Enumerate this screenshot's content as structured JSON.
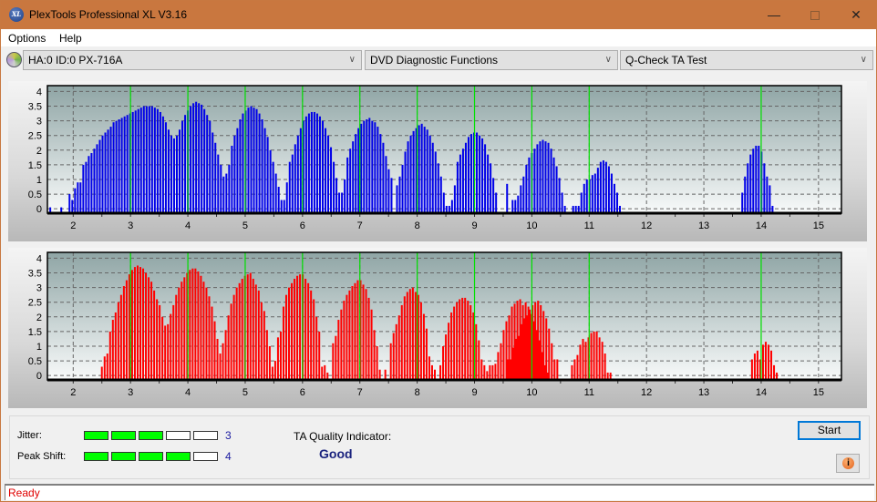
{
  "window": {
    "title": "PlexTools Professional XL V3.16",
    "app_icon_text": "XL",
    "minimize": "—",
    "close": "✕"
  },
  "menu": {
    "items": [
      "Options",
      "Help"
    ]
  },
  "toolbar": {
    "drive": "HA:0 ID:0  PX-716A",
    "function": "DVD Diagnostic Functions",
    "test": "Q-Check TA Test",
    "chevron": "∨"
  },
  "metrics": {
    "jitter_label": "Jitter:",
    "jitter_value": "3",
    "jitter_level": 3,
    "peak_shift_label": "Peak Shift:",
    "peak_shift_value": "4",
    "peak_shift_level": 4,
    "max_level": 5,
    "ta_quality_label": "TA Quality Indicator:",
    "ta_quality_value": "Good"
  },
  "buttons": {
    "start": "Start",
    "info": "i"
  },
  "status": {
    "text": "Ready"
  },
  "colors": {
    "blue_bars": "#0000e8",
    "red_bars": "#ff0000",
    "marker_lines": "#00e000",
    "meter_on": "#00ff00",
    "status_text": "#e00000",
    "quality_text": "#1a237e"
  },
  "chart_data": [
    {
      "type": "bar",
      "name": "top-chart",
      "title": "",
      "xlabel": "",
      "ylabel": "",
      "xlim": [
        1.55,
        15.4
      ],
      "ylim": [
        -0.15,
        4.2
      ],
      "x_ticks": [
        2,
        3,
        4,
        5,
        6,
        7,
        8,
        9,
        10,
        11,
        12,
        13,
        14,
        15
      ],
      "y_ticks": [
        0,
        0.5,
        1,
        1.5,
        2,
        2.5,
        3,
        3.5,
        4
      ],
      "y_tick_labels": [
        "0",
        "0.5",
        "1",
        "1.5",
        "2",
        "2.5",
        "3",
        "3.5",
        "4"
      ],
      "marker_lines": [
        3,
        4,
        5,
        6,
        7,
        8,
        9,
        10,
        11,
        14
      ],
      "grid": true,
      "x_start": 1.6,
      "x_step": 0.048,
      "values": [
        0.05,
        0,
        0,
        0,
        0.05,
        0,
        0,
        0.5,
        0.3,
        0.7,
        0.9,
        0.9,
        1.5,
        1.6,
        1.8,
        1.9,
        2.05,
        2.2,
        2.35,
        2.5,
        2.6,
        2.7,
        2.8,
        2.95,
        3.0,
        3.05,
        3.1,
        3.15,
        3.2,
        3.25,
        3.3,
        3.35,
        3.4,
        3.45,
        3.5,
        3.5,
        3.5,
        3.5,
        3.45,
        3.4,
        3.3,
        3.15,
        2.95,
        2.7,
        2.5,
        2.4,
        2.5,
        2.7,
        3.0,
        3.2,
        3.35,
        3.5,
        3.6,
        3.65,
        3.6,
        3.55,
        3.4,
        3.2,
        3.0,
        2.6,
        2.25,
        1.85,
        1.5,
        1.1,
        1.2,
        1.5,
        2.15,
        2.5,
        2.75,
        3.05,
        3.25,
        3.35,
        3.45,
        3.5,
        3.45,
        3.4,
        3.25,
        3.05,
        2.75,
        2.45,
        2.0,
        1.6,
        1.2,
        0.75,
        0.3,
        0.3,
        0.9,
        1.6,
        1.85,
        2.2,
        2.5,
        2.75,
        3.0,
        3.15,
        3.25,
        3.3,
        3.3,
        3.25,
        3.15,
        3.0,
        2.75,
        2.5,
        2.1,
        1.6,
        1.05,
        0.55,
        0.55,
        1.0,
        1.75,
        2.05,
        2.3,
        2.55,
        2.75,
        2.9,
        3.0,
        3.05,
        3.1,
        3.0,
        2.95,
        2.8,
        2.55,
        2.25,
        1.8,
        1.35,
        1.05,
        0.0,
        0.8,
        1.1,
        1.5,
        1.95,
        2.3,
        2.5,
        2.65,
        2.75,
        2.85,
        2.9,
        2.8,
        2.7,
        2.5,
        2.25,
        1.95,
        1.55,
        1.1,
        0.55,
        0.1,
        0.1,
        0.3,
        0.8,
        1.6,
        1.85,
        2.05,
        2.25,
        2.45,
        2.55,
        2.6,
        2.6,
        2.5,
        2.4,
        2.2,
        1.85,
        1.55,
        1.05,
        0.55,
        0.0,
        0.0,
        0.0,
        0.85,
        0.0,
        0.3,
        0.3,
        0.45,
        0.8,
        1.1,
        1.5,
        1.75,
        1.9,
        2.05,
        2.2,
        2.3,
        2.35,
        2.3,
        2.25,
        2.05,
        1.75,
        1.45,
        1.05,
        0.55,
        0.1,
        0,
        0,
        0.1,
        0.1,
        0.1,
        0.55,
        0.85,
        1.0,
        1.0,
        1.15,
        1.2,
        1.4,
        1.6,
        1.65,
        1.6,
        1.45,
        1.2,
        0.85,
        0.55,
        0.1
      ],
      "cluster_14": {
        "x_start": 13.67,
        "x_step": 0.048,
        "values": [
          0.55,
          1.1,
          1.55,
          1.85,
          2.05,
          2.15,
          2.15,
          1.95,
          1.55,
          1.1,
          0.8,
          0.1
        ]
      }
    },
    {
      "type": "bar",
      "name": "bottom-chart",
      "title": "",
      "xlabel": "",
      "ylabel": "",
      "xlim": [
        1.55,
        15.4
      ],
      "ylim": [
        -0.15,
        4.2
      ],
      "x_ticks": [
        2,
        3,
        4,
        5,
        6,
        7,
        8,
        9,
        10,
        11,
        12,
        13,
        14,
        15
      ],
      "y_ticks": [
        0,
        0.5,
        1,
        1.5,
        2,
        2.5,
        3,
        3.5,
        4
      ],
      "y_tick_labels": [
        "0",
        "0.5",
        "1",
        "1.5",
        "2",
        "2.5",
        "3",
        "3.5",
        "4"
      ],
      "marker_lines": [
        3,
        4,
        5,
        6,
        7,
        8,
        9,
        10,
        11,
        14
      ],
      "grid": true,
      "x_start": 2.5,
      "x_step": 0.048,
      "values": [
        0.3,
        0.65,
        0.75,
        1.5,
        1.9,
        2.15,
        2.5,
        2.75,
        3.05,
        3.25,
        3.45,
        3.6,
        3.7,
        3.75,
        3.7,
        3.65,
        3.5,
        3.35,
        3.2,
        2.9,
        2.6,
        2.4,
        2.0,
        1.7,
        1.75,
        2.1,
        2.4,
        2.75,
        3.0,
        3.2,
        3.35,
        3.5,
        3.6,
        3.65,
        3.65,
        3.55,
        3.4,
        3.2,
        3.0,
        2.7,
        2.35,
        1.85,
        1.25,
        0.75,
        1.1,
        1.55,
        2.05,
        2.45,
        2.75,
        3.0,
        3.15,
        3.3,
        3.4,
        3.45,
        3.5,
        3.3,
        3.1,
        2.9,
        2.5,
        2.2,
        1.55,
        1.0,
        0.3,
        0.5,
        1.3,
        1.5,
        2.35,
        2.75,
        3.0,
        3.15,
        3.3,
        3.4,
        3.45,
        3.45,
        3.3,
        3.15,
        2.9,
        2.6,
        2.0,
        1.5,
        0.3,
        0.35,
        0.1,
        0,
        1.1,
        1.35,
        1.9,
        2.25,
        2.55,
        2.75,
        2.9,
        3.05,
        3.15,
        3.25,
        3.25,
        3.1,
        2.95,
        2.65,
        2.25,
        1.55,
        1.0,
        0.2,
        0.0,
        0.2,
        0.0,
        1.1,
        1.45,
        1.75,
        2.05,
        2.4,
        2.7,
        2.85,
        2.95,
        3.0,
        2.85,
        2.75,
        2.5,
        2.1,
        1.6,
        0.65,
        0.35,
        0.2,
        0.0,
        0.35,
        1.0,
        1.4,
        1.8,
        2.15,
        2.35,
        2.5,
        2.6,
        2.65,
        2.65,
        2.55,
        2.4,
        2.15,
        1.75,
        1.2,
        0.55,
        0.35,
        0.15,
        0.35,
        0.35,
        0.4,
        0.8,
        1.1,
        1.55,
        1.85,
        2.05,
        2.35,
        2.45,
        2.55,
        2.6,
        2.4,
        2.5,
        2.35,
        2.1,
        1.85,
        1.55,
        1.2,
        0.8,
        0.35,
        0.1
      ],
      "cluster_10": {
        "x_start": 9.58,
        "x_step": 0.048,
        "values": [
          0.55,
          0.55,
          0.95,
          1.25,
          1.35,
          1.75,
          1.95,
          2.05,
          2.25,
          2.4,
          2.5,
          2.55,
          2.4,
          2.2,
          1.95,
          1.6,
          1.1,
          0.55,
          0.55
        ]
      },
      "cluster_11": {
        "x_start": 10.7,
        "x_step": 0.048,
        "values": [
          0.35,
          0.55,
          0.7,
          1.05,
          1.25,
          1.15,
          1.3,
          1.45,
          1.5,
          1.5,
          1.3,
          1.15,
          0.75,
          0.1,
          0.1
        ]
      },
      "cluster_14": {
        "x_start": 13.84,
        "x_step": 0.048,
        "values": [
          0.55,
          0.75,
          0.85,
          0.55,
          1.05,
          1.15,
          1.05,
          0.85,
          0.35,
          0.1
        ]
      }
    }
  ]
}
